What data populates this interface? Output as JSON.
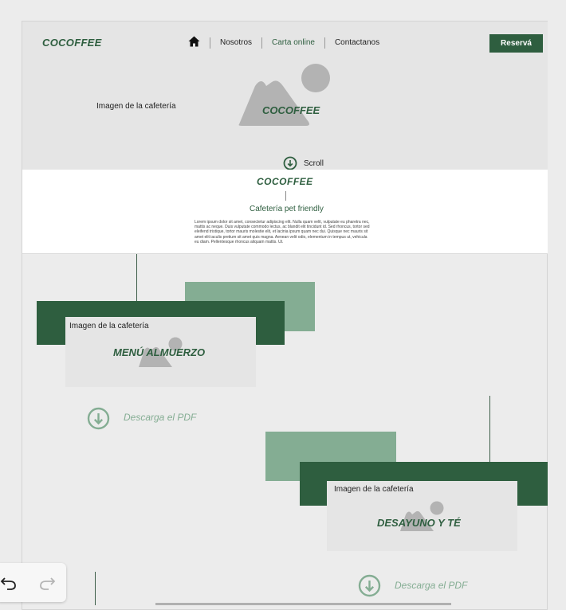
{
  "header": {
    "logo": "COCOFFEE",
    "nav": [
      "Nosotros",
      "Carta online",
      "Contactanos"
    ],
    "cta": "Reservá"
  },
  "hero": {
    "caption": "Imagen de la cafetería",
    "brand": "COCOFFEE",
    "scroll_label": "Scroll"
  },
  "intro": {
    "brand": "COCOFFEE",
    "tagline": "Cafetería pet friendly",
    "body": "Lorem ipsum dolor sit amet, consectetur adipiscing elit. Nulla quam velit, vulputate eu pharetra nec, mattis ac neque. Duis vulputate commodo lectus, ac blandit elit tincidunt id. Sed rhoncus, tortor sed eleifend tristique, tortor mauris molestie elit, et lacinia ipsum quam nec dui. Quisque nec mauris sit amet elit iaculis pretium sit amet quis magna. Aenean velit odio, elementum in tempus ut, vehicula eu diam. Pellentesque rhoncus aliquam mattis. Ut."
  },
  "menus": [
    {
      "caption": "Imagen de la cafetería",
      "title": "MENÚ ALMUERZO",
      "download": "Descarga el PDF"
    },
    {
      "caption": "Imagen de la cafetería",
      "title": "DESAYUNO Y TÉ",
      "download": "Descarga el PDF"
    }
  ],
  "colors": {
    "brand_dark": "#2e5e3f",
    "brand_light": "#84ad93",
    "placeholder": "#b3b3b3"
  }
}
